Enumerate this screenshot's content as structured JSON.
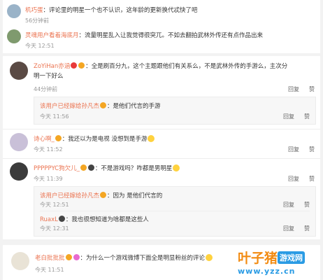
{
  "colors": {
    "name": "#eb7350",
    "meta": "#999999",
    "accent": "#f28b12",
    "brand_blue": "#2a9be4"
  },
  "reply_label": "回复",
  "like_label": "赞",
  "top_card": {
    "c1": {
      "name": "机巧蛋",
      "text": "：评论里的明星一个也不认识，这年龄的更新换代忒快了吧",
      "time": "56分钟前"
    },
    "c2": {
      "name": "灵魂用户看着海底月",
      "text": "：流量明星乱入让我觉得很突兀。不如去翻拍武林外传还有点作品出来",
      "time": "今天 12:51"
    }
  },
  "main_card": {
    "c3": {
      "name": "ZoYiHan亦涵",
      "text_line1": "：全是刷百分九，这个主题跟他们有关系么，不是武林外传的手游么，主次分",
      "text_line2": "明一下好么",
      "time": "44分钟前",
      "reply": {
        "name": "该用户已经嫁给孙凡杰",
        "text": "：是他们代言的手游",
        "time": "今天 11:56"
      }
    },
    "c4": {
      "name": "诗心啊_",
      "text": "：我还以为是电视 没想到是手游",
      "time": "今天 11:52"
    },
    "c5": {
      "name": "PPPPPYC狗欠儿_",
      "text": "：不是游戏吗？咋都是男明星",
      "time": "今天 11:39",
      "reply1": {
        "name": "该用户已经嫁给孙凡杰",
        "text": "：因为 是他们代言的",
        "time": "今天 12:51"
      },
      "reply2": {
        "name": "RuaxL",
        "text": "：我也很想知道为啥都是这些人",
        "time": "今天 12:31"
      }
    }
  },
  "bottom_card": {
    "c6": {
      "name": "老白批批批",
      "text": "：为什么一个游戏微博下面全是明显粉丝的评论",
      "time": "今天 11:51"
    }
  },
  "watermark": {
    "brand": "叶子猪",
    "tag": "游戏网",
    "url": "www.yzz.cn"
  }
}
